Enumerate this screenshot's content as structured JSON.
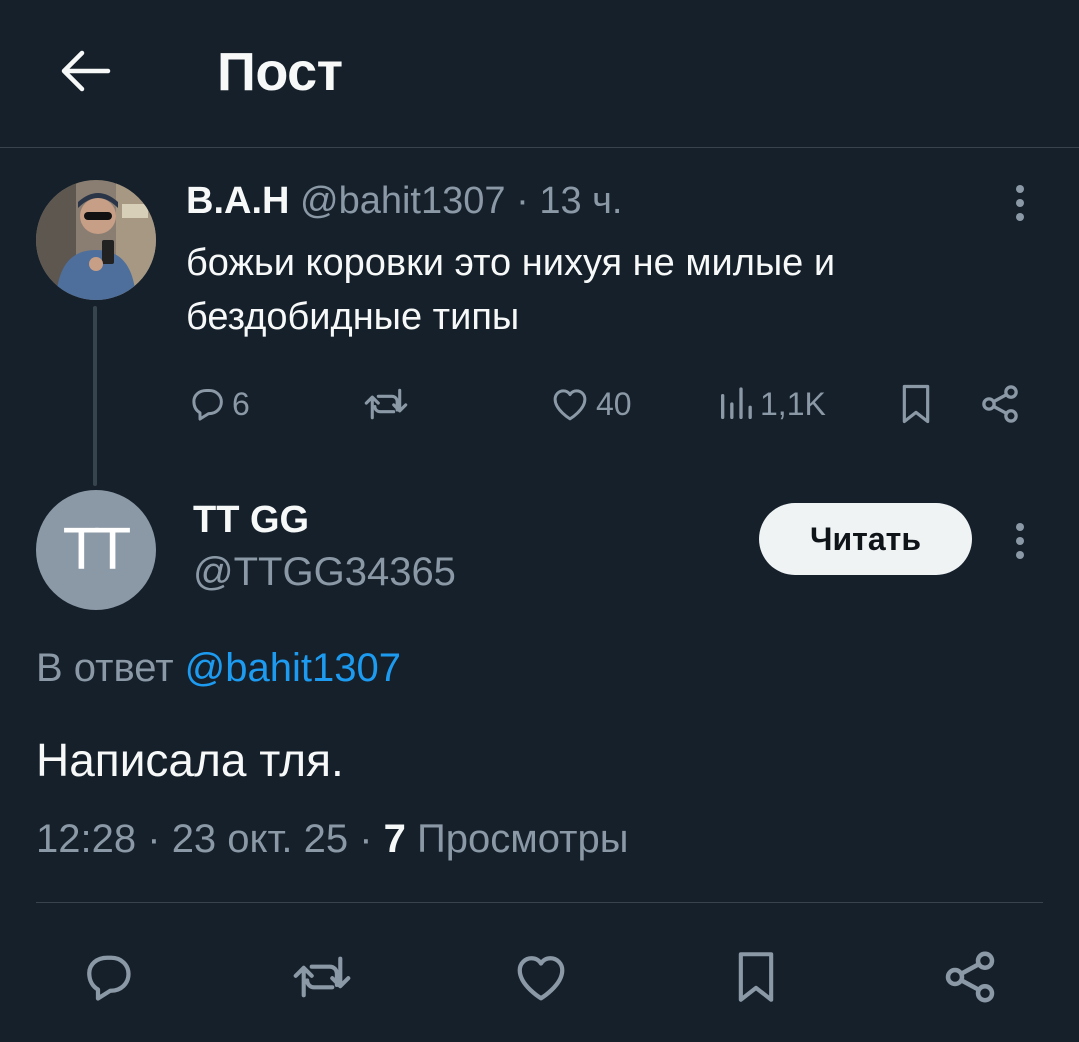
{
  "header": {
    "title": "Пост",
    "back_icon": "arrow-left-icon"
  },
  "parent_tweet": {
    "author_name": "B.A.H",
    "handle": "@bahit1307",
    "separator": "·",
    "time": "13 ч.",
    "text": "божьи коровки это нихуя не милые и бездобидные типы",
    "actions": {
      "replies": "6",
      "likes": "40",
      "views": "1,1K"
    }
  },
  "reply_tweet": {
    "avatar_initials": "TT",
    "author_name": "TT GG",
    "handle": "@TTGG34365",
    "follow_label": "Читать",
    "reply_prefix": "В ответ",
    "reply_handle": "@bahit1307",
    "text": "Написала тля.",
    "time": "12:28",
    "date": "23 окт. 25",
    "separator": "·",
    "views_count": "7",
    "views_label": "Просмотры"
  },
  "colors": {
    "background": "#15202b",
    "text": "#f7f9f9",
    "muted": "#8b98a5",
    "link": "#1d9bf0",
    "divider": "#38444d"
  }
}
